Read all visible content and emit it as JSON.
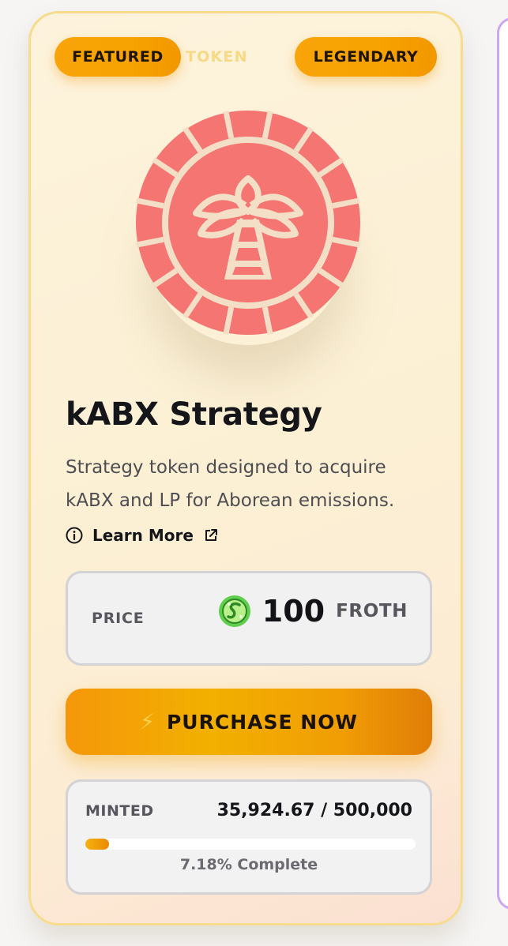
{
  "card": {
    "badges": {
      "featured": "FEATURED",
      "token": "TOKEN",
      "legendary": "LEGENDARY"
    },
    "logo_icon": "palm-tree-coin-icon",
    "logo_color": "#f47572",
    "title": "kABX Strategy",
    "description": "Strategy token designed to acquire kABX and LP for Aborean emissions.",
    "learn_more": "Learn More",
    "price": {
      "label": "PRICE",
      "value": "100",
      "currency": "FROTH",
      "currency_icon": "froth-coin-icon"
    },
    "purchase": {
      "icon": "lightning-icon",
      "label": "PURCHASE NOW"
    },
    "minted": {
      "label": "MINTED",
      "value": "35,924.67 / 500,000",
      "progress": 0.0718,
      "progress_text": "7.18% Complete"
    }
  },
  "colors": {
    "accent": "#f7a300",
    "card_border": "#f6dc8c",
    "side_card_border": "#cda6f2"
  }
}
